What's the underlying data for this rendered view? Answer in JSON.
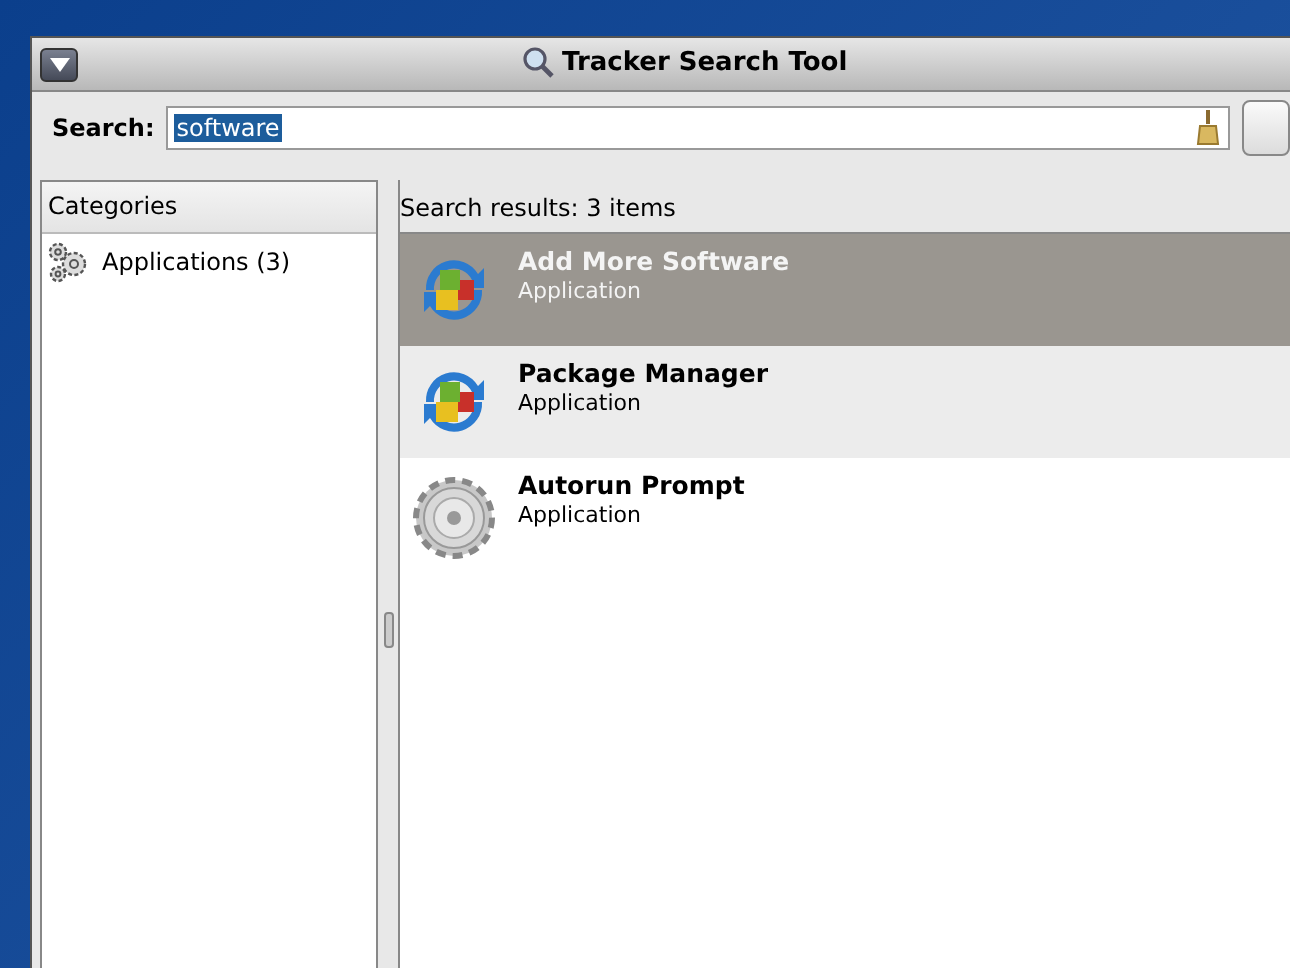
{
  "window": {
    "title": "Tracker Search Tool"
  },
  "search": {
    "label": "Search:",
    "value": "software",
    "selected_text": true
  },
  "categories": {
    "heading": "Categories",
    "items": [
      {
        "label": "Applications (3)",
        "selected": false
      }
    ]
  },
  "results": {
    "summary": "Search results: 3 items",
    "items": [
      {
        "name": "Add More Software",
        "type": "Application",
        "kind": "package",
        "selected": true
      },
      {
        "name": "Package Manager",
        "type": "Application",
        "kind": "package",
        "selected": false
      },
      {
        "name": "Autorun Prompt",
        "type": "Application",
        "kind": "gear",
        "selected": false
      }
    ]
  }
}
